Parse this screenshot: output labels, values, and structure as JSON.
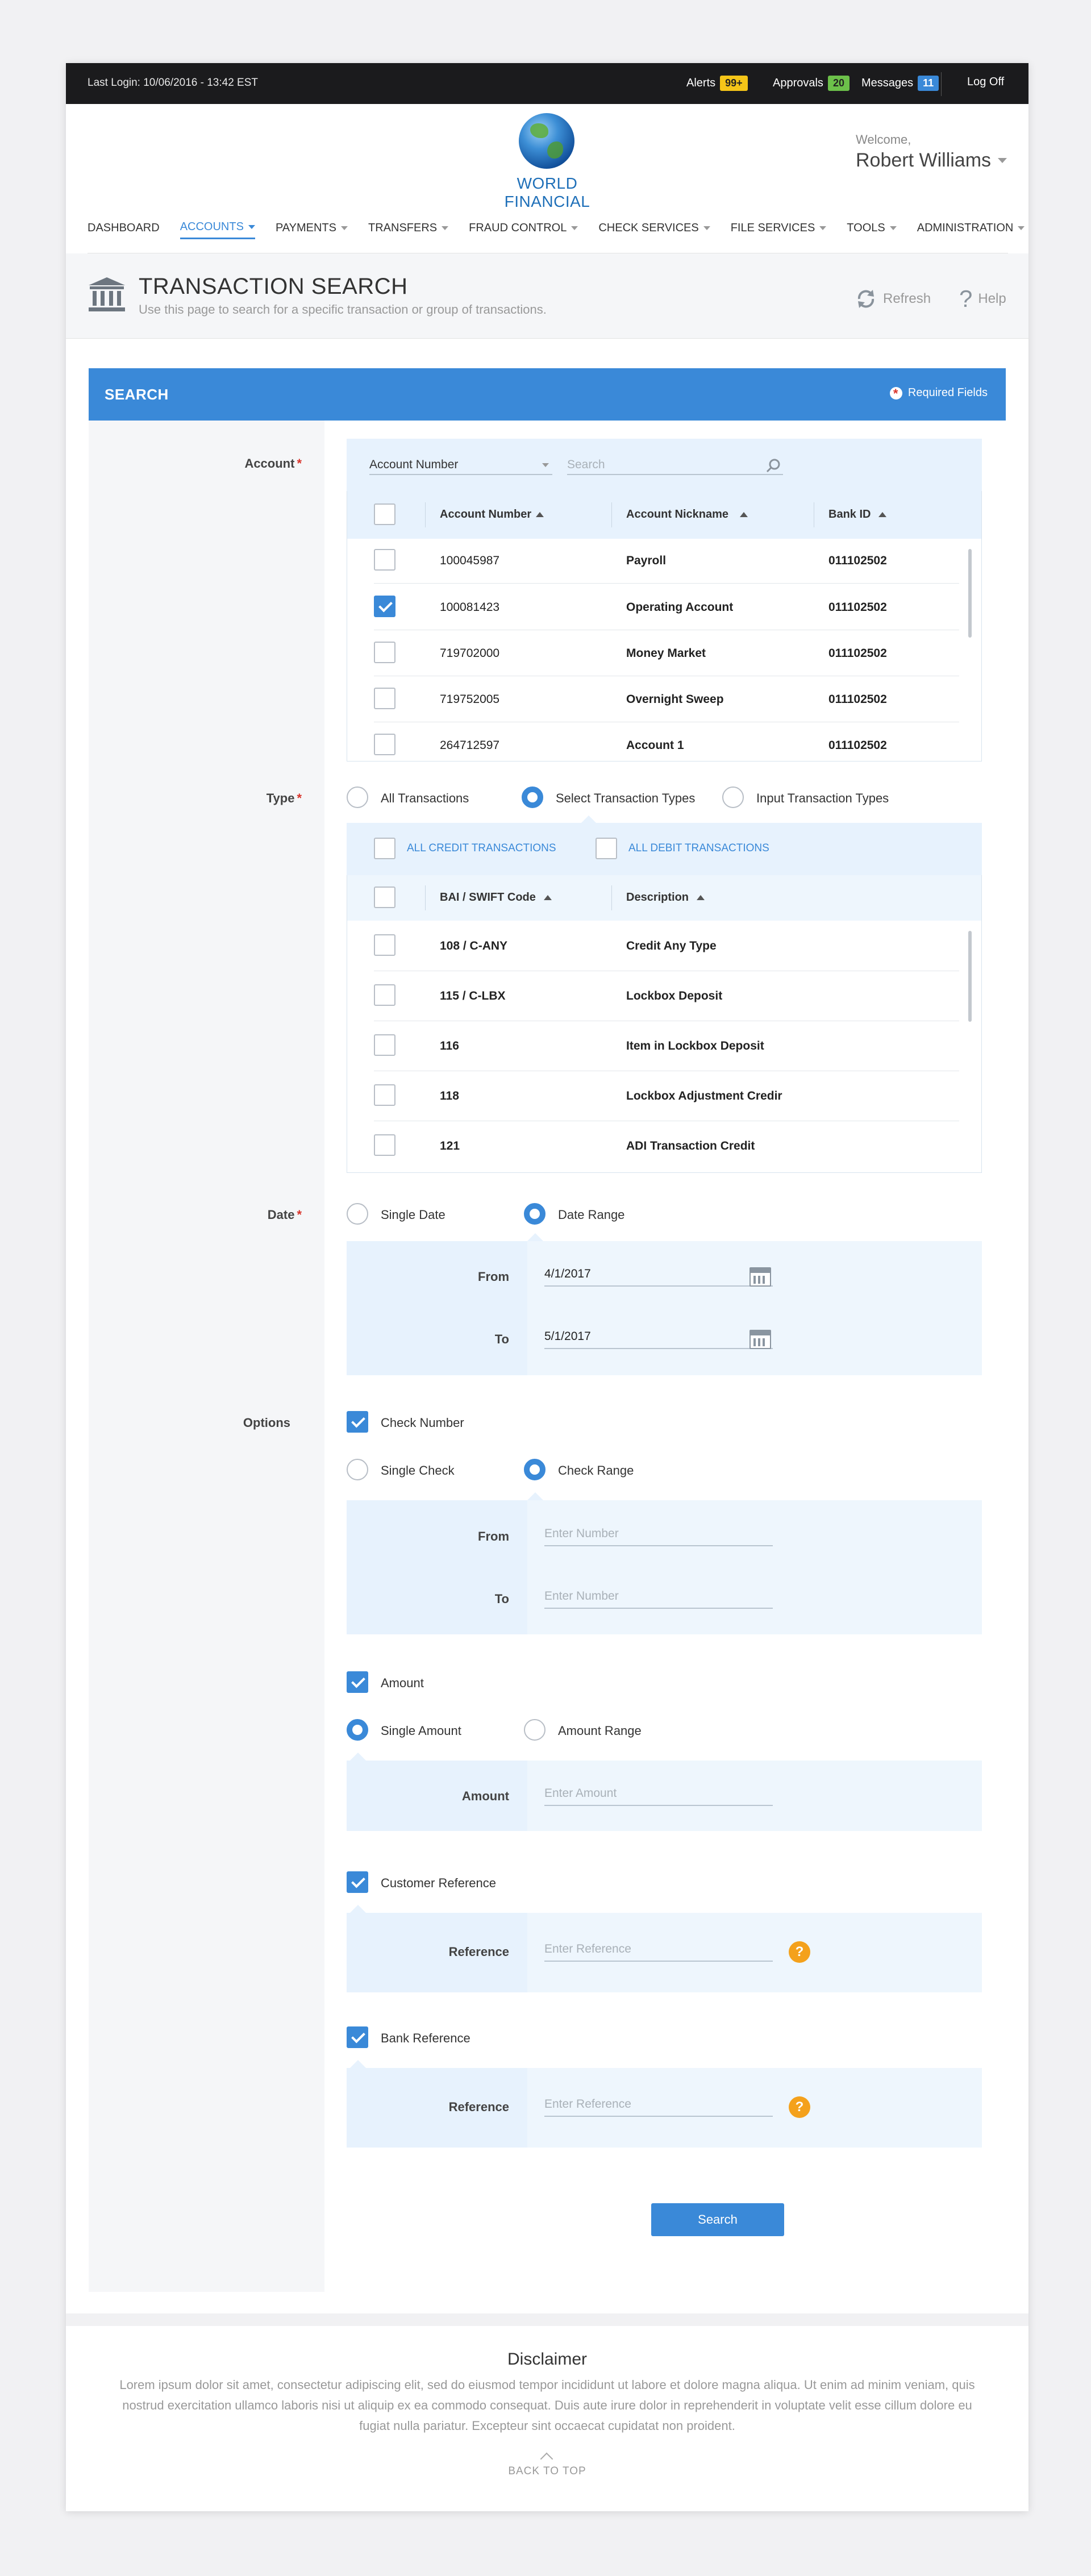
{
  "topbar": {
    "last_login": "Last Login: 10/06/2016 - 13:42 EST",
    "alerts_label": "Alerts",
    "alerts_count": "99+",
    "approvals_label": "Approvals",
    "approvals_count": "20",
    "messages_label": "Messages",
    "messages_count": "11",
    "logoff": "Log Off",
    "colors": {
      "alerts": "#f5c518",
      "approvals": "#6cc04a",
      "messages": "#3a89d8"
    }
  },
  "header": {
    "logo_text": "WORLD FINANCIAL",
    "welcome": "Welcome,",
    "user_name": "Robert Williams"
  },
  "nav": {
    "items": [
      {
        "label": "DASHBOARD"
      },
      {
        "label": "ACCOUNTS"
      },
      {
        "label": "PAYMENTS"
      },
      {
        "label": "TRANSFERS"
      },
      {
        "label": "FRAUD CONTROL"
      },
      {
        "label": "CHECK SERVICES"
      },
      {
        "label": "FILE SERVICES"
      },
      {
        "label": "TOOLS"
      },
      {
        "label": "ADMINISTRATION"
      }
    ]
  },
  "page": {
    "title": "TRANSACTION SEARCH",
    "subtitle": "Use this page to search for a specific transaction or group of transactions.",
    "refresh": "Refresh",
    "help": "Help"
  },
  "search": {
    "title": "SEARCH",
    "required": "Required Fields",
    "account": {
      "label": "Account",
      "filter_select": "Account Number",
      "search_placeholder": "Search",
      "columns": [
        "Account Number",
        "Account Nickname",
        "Bank ID"
      ],
      "rows": [
        {
          "number": "100045987",
          "nickname": "Payroll",
          "bank": "011102502",
          "checked": false
        },
        {
          "number": "100081423",
          "nickname": "Operating Account",
          "bank": "011102502",
          "checked": true
        },
        {
          "number": "719702000",
          "nickname": "Money Market",
          "bank": "011102502",
          "checked": false
        },
        {
          "number": "719752005",
          "nickname": "Overnight Sweep",
          "bank": "011102502",
          "checked": false
        },
        {
          "number": "264712597",
          "nickname": "Account 1",
          "bank": "011102502",
          "checked": false
        }
      ]
    },
    "type": {
      "label": "Type",
      "options": [
        "All Transactions",
        "Select Transaction Types",
        "Input Transaction Types"
      ],
      "selected": "Select Transaction Types",
      "all_credit": "ALL CREDIT TRANSACTIONS",
      "all_debit": "ALL DEBIT TRANSACTIONS",
      "columns": [
        "BAI / SWIFT Code",
        "Description"
      ],
      "rows": [
        {
          "code": "108 / C-ANY",
          "desc": "Credit Any Type"
        },
        {
          "code": "115 / C-LBX",
          "desc": "Lockbox Deposit"
        },
        {
          "code": "116",
          "desc": "Item in Lockbox Deposit"
        },
        {
          "code": "118",
          "desc": "Lockbox Adjustment Credir"
        },
        {
          "code": "121",
          "desc": "ADI Transaction Credit"
        }
      ]
    },
    "date": {
      "label": "Date",
      "options": [
        "Single Date",
        "Date Range"
      ],
      "selected": "Date Range",
      "from_label": "From",
      "from_value": "4/1/2017",
      "to_label": "To",
      "to_value": "5/1/2017"
    },
    "options": {
      "label": "Options",
      "check_number": "Check Number",
      "check_options": [
        "Single Check",
        "Check Range"
      ],
      "check_selected": "Check Range",
      "check_from_label": "From",
      "check_to_label": "To",
      "number_placeholder": "Enter Number",
      "amount": "Amount",
      "amount_options": [
        "Single Amount",
        "Amount Range"
      ],
      "amount_selected": "Single Amount",
      "amount_label": "Amount",
      "amount_placeholder": "Enter Amount",
      "customer_reference": "Customer Reference",
      "reference_label": "Reference",
      "reference_placeholder": "Enter Reference",
      "bank_reference": "Bank Reference"
    },
    "button": "Search"
  },
  "footer": {
    "disclaimer_title": "Disclaimer",
    "disclaimer_text": "Lorem ipsum dolor sit amet, consectetur adipiscing elit, sed do eiusmod tempor incididunt ut labore et dolore magna aliqua. Ut enim ad minim veniam, quis nostrud exercitation ullamco laboris nisi ut aliquip ex ea commodo consequat. Duis aute irure dolor in reprehenderit in voluptate velit esse cillum dolore eu fugiat nulla pariatur. Excepteur sint occaecat cupidatat non proident.",
    "back_to_top": "BACK TO TOP"
  }
}
